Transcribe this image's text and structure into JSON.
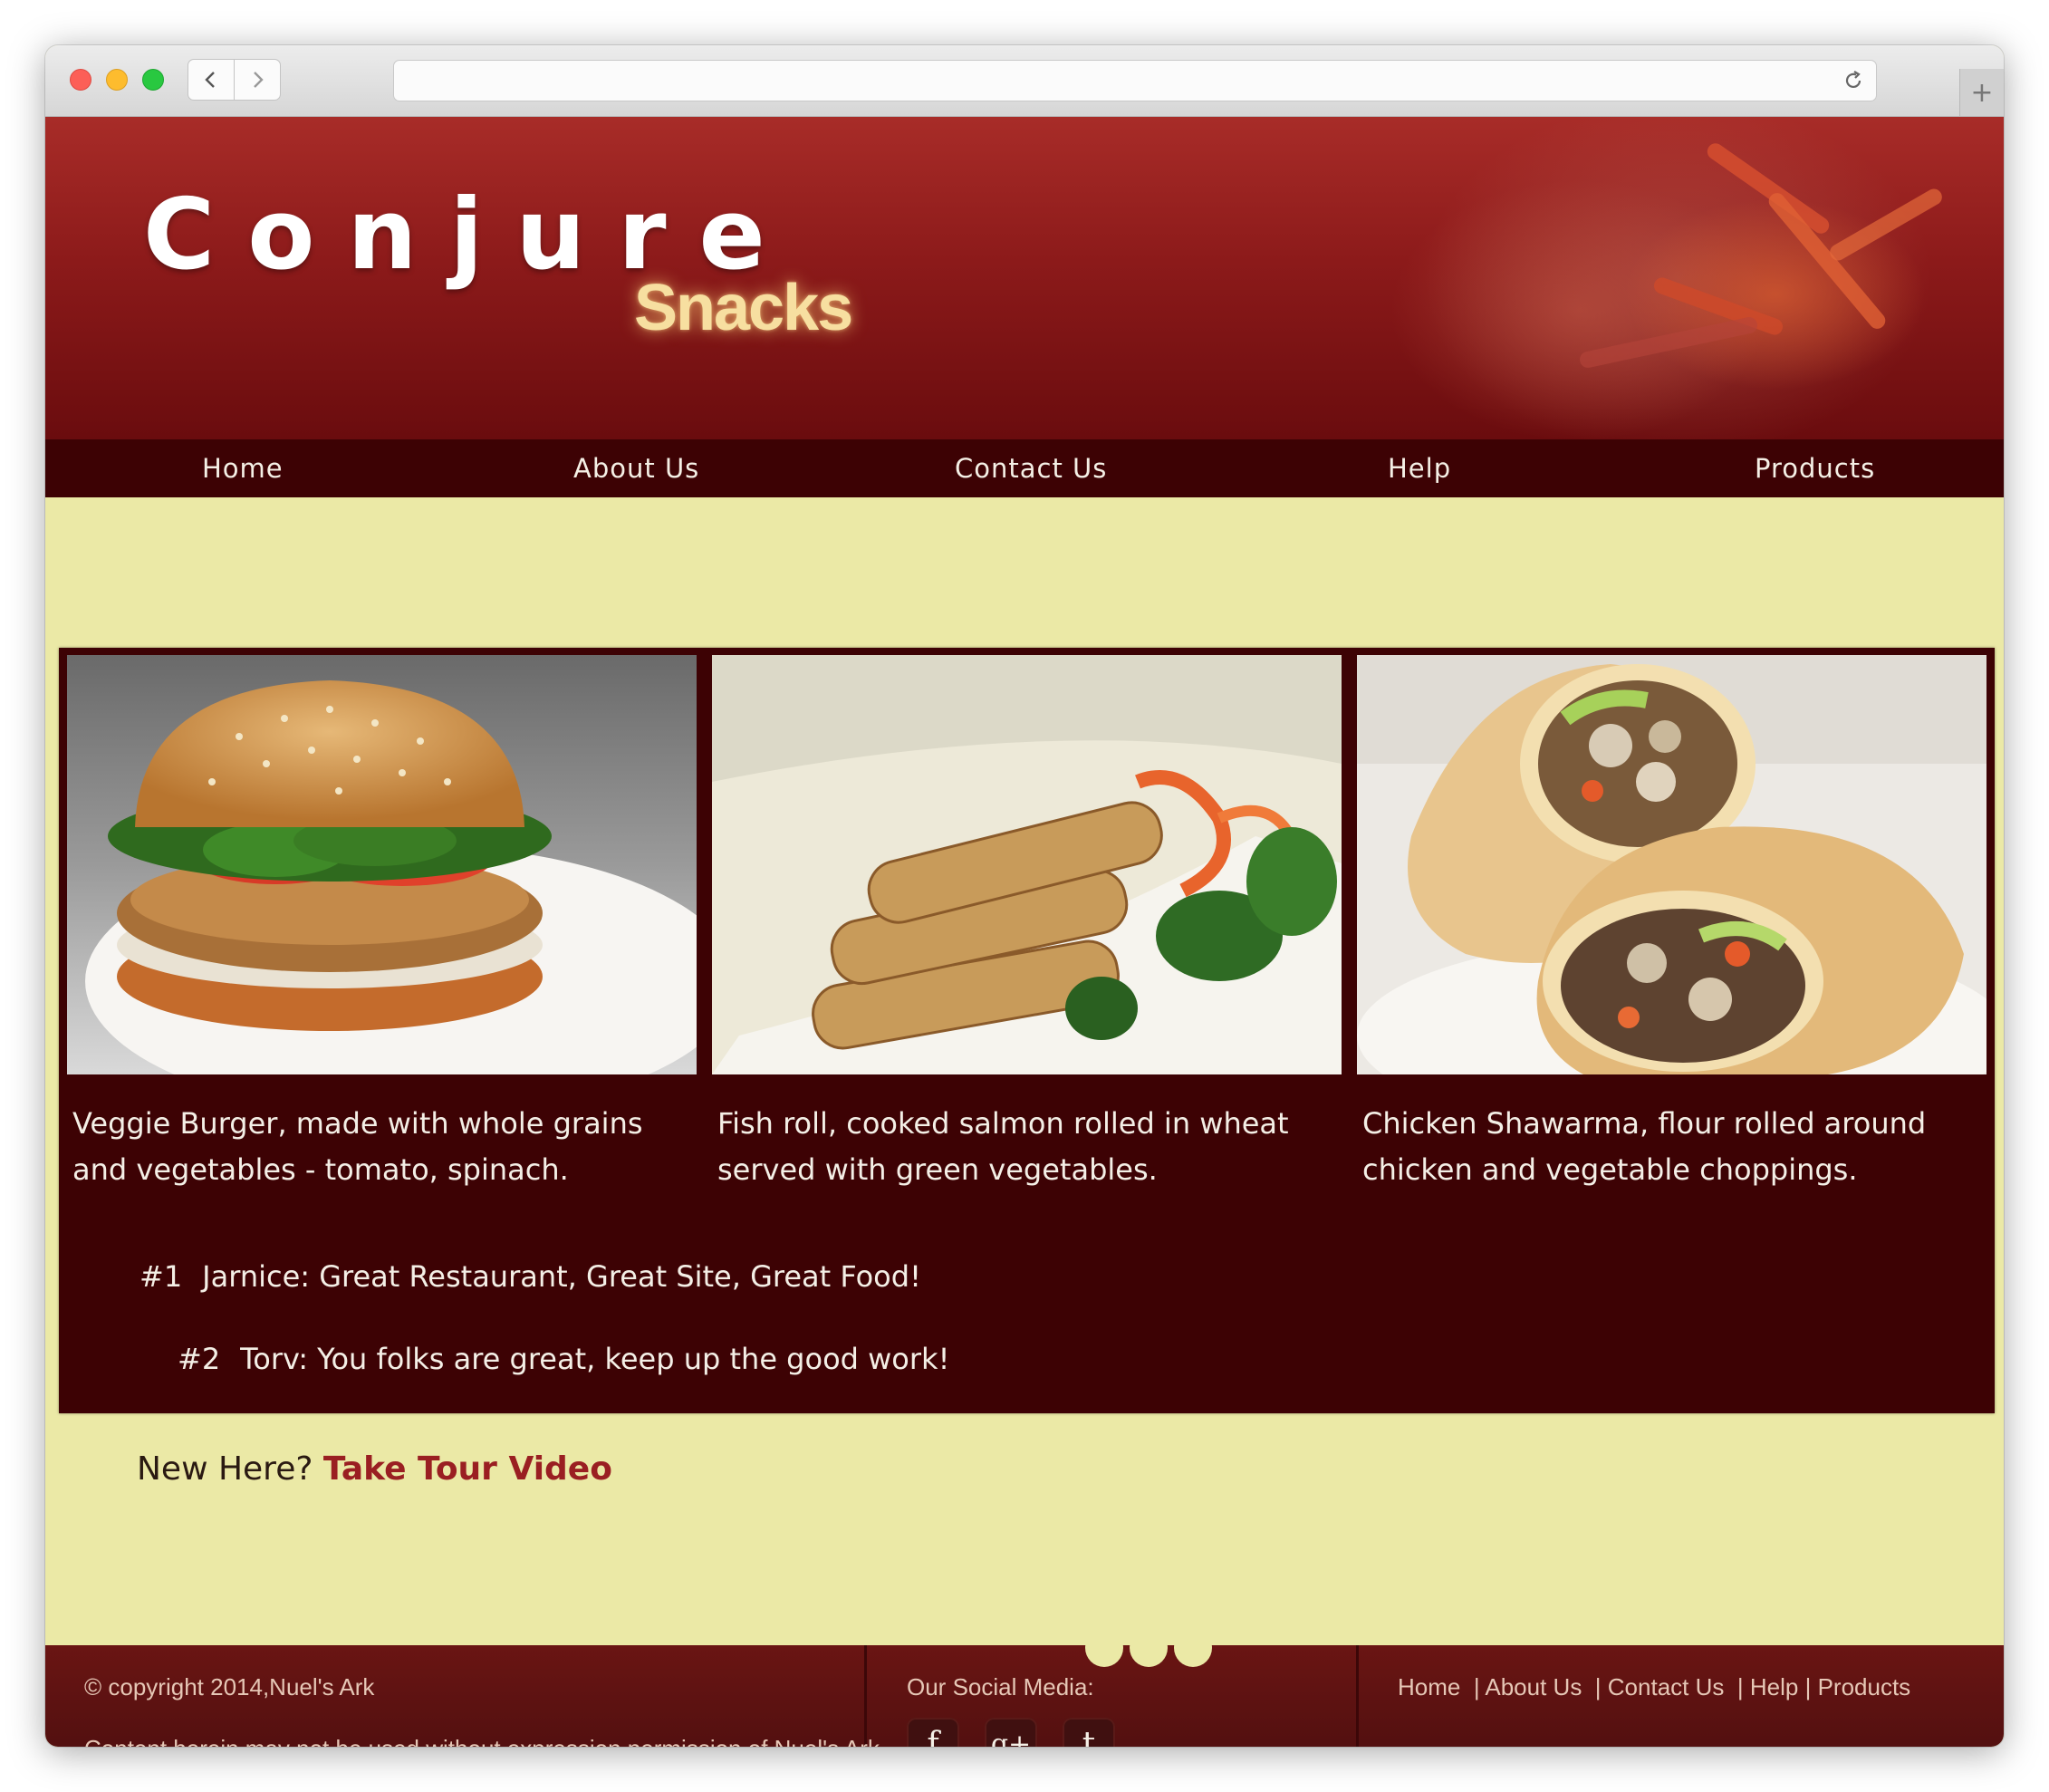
{
  "browser": {
    "url": ""
  },
  "brand": {
    "name": "Conjure",
    "tagline": "Snacks"
  },
  "nav": {
    "items": [
      {
        "label": "Home"
      },
      {
        "label": "About Us"
      },
      {
        "label": "Contact Us"
      },
      {
        "label": "Help"
      },
      {
        "label": "Products"
      }
    ]
  },
  "gallery": {
    "items": [
      {
        "caption": "Veggie Burger, made with whole grains and vegetables - tomato, spinach."
      },
      {
        "caption": "Fish roll, cooked salmon rolled in wheat served with green vegetables."
      },
      {
        "caption": "Chicken Shawarma, flour rolled around chicken and vegetable choppings."
      }
    ]
  },
  "reviews": [
    {
      "num": "#1",
      "text": "Jarnice: Great Restaurant, Great Site, Great Food!"
    },
    {
      "num": "#2",
      "text": "Torv: You folks are great, keep up the good work!"
    }
  ],
  "cta": {
    "prefix": "New Here?",
    "link": "Take Tour Video"
  },
  "footer": {
    "copyright": "© copyright 2014,Nuel's Ark",
    "notice": "Content herein may not be used without expression permission of Nuel's Ark",
    "social_heading": "Our Social Media:",
    "social": [
      {
        "icon": "facebook-icon",
        "glyph": "f"
      },
      {
        "icon": "google-plus-icon",
        "glyph": "g+"
      },
      {
        "icon": "tumblr-icon",
        "glyph": "t"
      }
    ],
    "links": [
      "Home",
      "About Us",
      "Contact Us",
      "Help",
      "Products"
    ]
  },
  "colors": {
    "header_red": "#8c1a1a",
    "nav_bg": "#3d0204",
    "page_bg": "#ebe9a6",
    "accent_link": "#9a1f22",
    "footer_bg": "#5a1212"
  }
}
